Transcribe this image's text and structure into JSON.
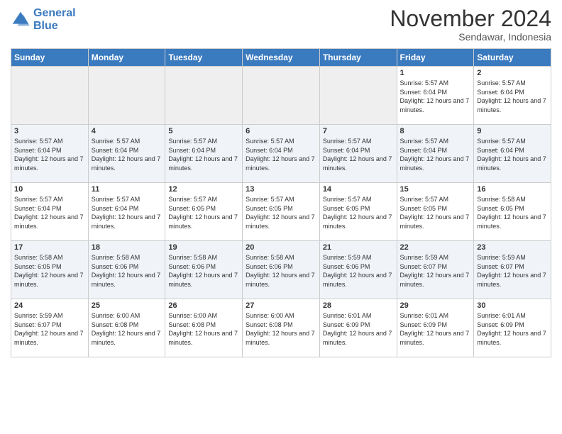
{
  "header": {
    "logo_line1": "General",
    "logo_line2": "Blue",
    "month_title": "November 2024",
    "subtitle": "Sendawar, Indonesia"
  },
  "weekdays": [
    "Sunday",
    "Monday",
    "Tuesday",
    "Wednesday",
    "Thursday",
    "Friday",
    "Saturday"
  ],
  "rows": [
    [
      {
        "day": "",
        "info": ""
      },
      {
        "day": "",
        "info": ""
      },
      {
        "day": "",
        "info": ""
      },
      {
        "day": "",
        "info": ""
      },
      {
        "day": "",
        "info": ""
      },
      {
        "day": "1",
        "info": "Sunrise: 5:57 AM\nSunset: 6:04 PM\nDaylight: 12 hours and 7 minutes."
      },
      {
        "day": "2",
        "info": "Sunrise: 5:57 AM\nSunset: 6:04 PM\nDaylight: 12 hours and 7 minutes."
      }
    ],
    [
      {
        "day": "3",
        "info": "Sunrise: 5:57 AM\nSunset: 6:04 PM\nDaylight: 12 hours and 7 minutes."
      },
      {
        "day": "4",
        "info": "Sunrise: 5:57 AM\nSunset: 6:04 PM\nDaylight: 12 hours and 7 minutes."
      },
      {
        "day": "5",
        "info": "Sunrise: 5:57 AM\nSunset: 6:04 PM\nDaylight: 12 hours and 7 minutes."
      },
      {
        "day": "6",
        "info": "Sunrise: 5:57 AM\nSunset: 6:04 PM\nDaylight: 12 hours and 7 minutes."
      },
      {
        "day": "7",
        "info": "Sunrise: 5:57 AM\nSunset: 6:04 PM\nDaylight: 12 hours and 7 minutes."
      },
      {
        "day": "8",
        "info": "Sunrise: 5:57 AM\nSunset: 6:04 PM\nDaylight: 12 hours and 7 minutes."
      },
      {
        "day": "9",
        "info": "Sunrise: 5:57 AM\nSunset: 6:04 PM\nDaylight: 12 hours and 7 minutes."
      }
    ],
    [
      {
        "day": "10",
        "info": "Sunrise: 5:57 AM\nSunset: 6:04 PM\nDaylight: 12 hours and 7 minutes."
      },
      {
        "day": "11",
        "info": "Sunrise: 5:57 AM\nSunset: 6:04 PM\nDaylight: 12 hours and 7 minutes."
      },
      {
        "day": "12",
        "info": "Sunrise: 5:57 AM\nSunset: 6:05 PM\nDaylight: 12 hours and 7 minutes."
      },
      {
        "day": "13",
        "info": "Sunrise: 5:57 AM\nSunset: 6:05 PM\nDaylight: 12 hours and 7 minutes."
      },
      {
        "day": "14",
        "info": "Sunrise: 5:57 AM\nSunset: 6:05 PM\nDaylight: 12 hours and 7 minutes."
      },
      {
        "day": "15",
        "info": "Sunrise: 5:57 AM\nSunset: 6:05 PM\nDaylight: 12 hours and 7 minutes."
      },
      {
        "day": "16",
        "info": "Sunrise: 5:58 AM\nSunset: 6:05 PM\nDaylight: 12 hours and 7 minutes."
      }
    ],
    [
      {
        "day": "17",
        "info": "Sunrise: 5:58 AM\nSunset: 6:05 PM\nDaylight: 12 hours and 7 minutes."
      },
      {
        "day": "18",
        "info": "Sunrise: 5:58 AM\nSunset: 6:06 PM\nDaylight: 12 hours and 7 minutes."
      },
      {
        "day": "19",
        "info": "Sunrise: 5:58 AM\nSunset: 6:06 PM\nDaylight: 12 hours and 7 minutes."
      },
      {
        "day": "20",
        "info": "Sunrise: 5:58 AM\nSunset: 6:06 PM\nDaylight: 12 hours and 7 minutes."
      },
      {
        "day": "21",
        "info": "Sunrise: 5:59 AM\nSunset: 6:06 PM\nDaylight: 12 hours and 7 minutes."
      },
      {
        "day": "22",
        "info": "Sunrise: 5:59 AM\nSunset: 6:07 PM\nDaylight: 12 hours and 7 minutes."
      },
      {
        "day": "23",
        "info": "Sunrise: 5:59 AM\nSunset: 6:07 PM\nDaylight: 12 hours and 7 minutes."
      }
    ],
    [
      {
        "day": "24",
        "info": "Sunrise: 5:59 AM\nSunset: 6:07 PM\nDaylight: 12 hours and 7 minutes."
      },
      {
        "day": "25",
        "info": "Sunrise: 6:00 AM\nSunset: 6:08 PM\nDaylight: 12 hours and 7 minutes."
      },
      {
        "day": "26",
        "info": "Sunrise: 6:00 AM\nSunset: 6:08 PM\nDaylight: 12 hours and 7 minutes."
      },
      {
        "day": "27",
        "info": "Sunrise: 6:00 AM\nSunset: 6:08 PM\nDaylight: 12 hours and 7 minutes."
      },
      {
        "day": "28",
        "info": "Sunrise: 6:01 AM\nSunset: 6:09 PM\nDaylight: 12 hours and 7 minutes."
      },
      {
        "day": "29",
        "info": "Sunrise: 6:01 AM\nSunset: 6:09 PM\nDaylight: 12 hours and 7 minutes."
      },
      {
        "day": "30",
        "info": "Sunrise: 6:01 AM\nSunset: 6:09 PM\nDaylight: 12 hours and 7 minutes."
      }
    ]
  ]
}
